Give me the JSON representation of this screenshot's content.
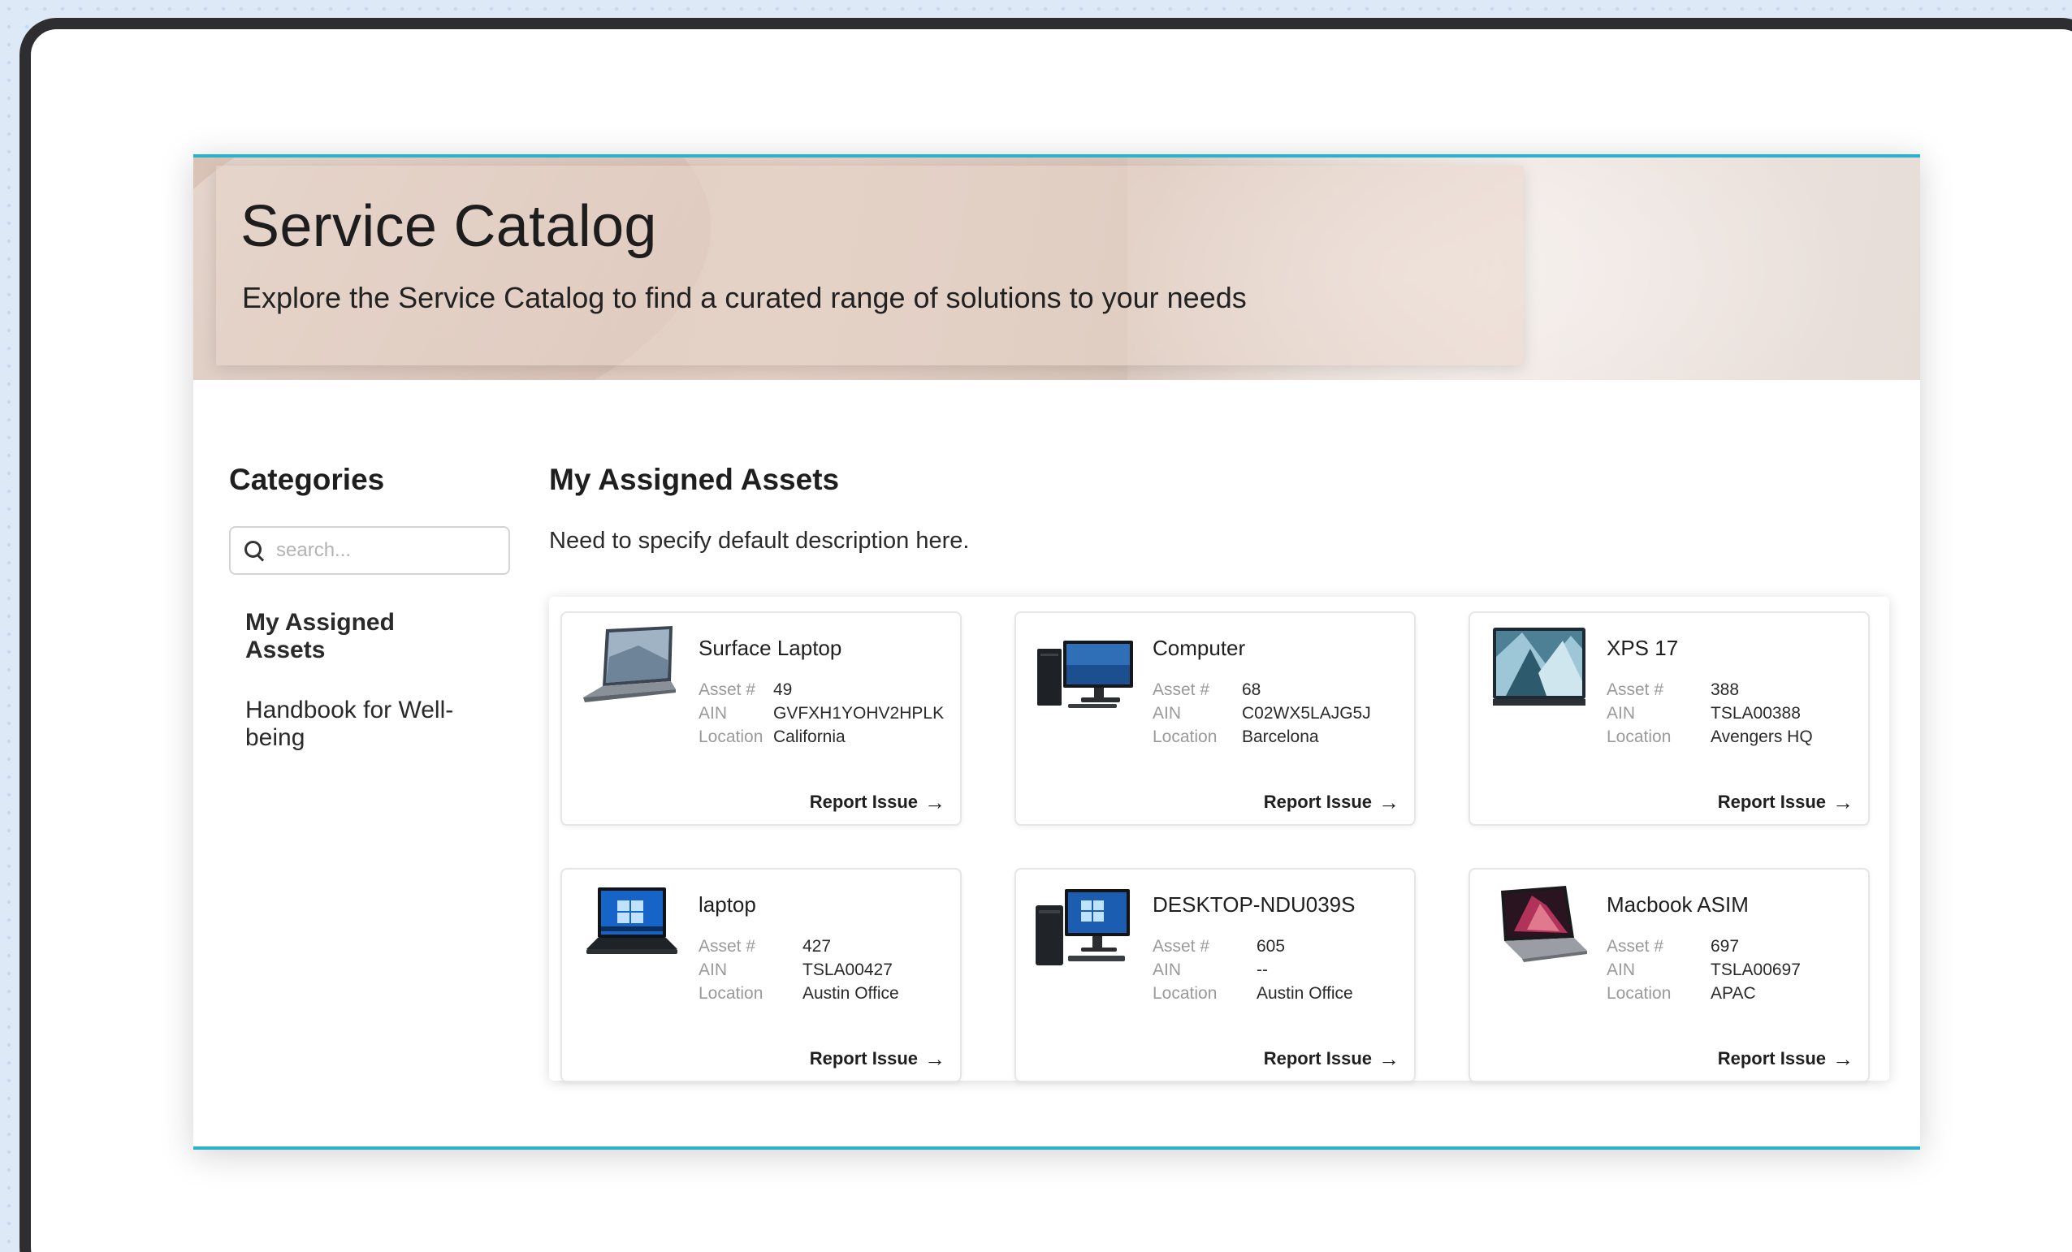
{
  "header": {
    "title": "Service Catalog",
    "subtitle": "Explore the Service Catalog to find a curated range of solutions to your needs"
  },
  "sidebar": {
    "title": "Categories",
    "search_placeholder": "search...",
    "items": [
      {
        "label": "My Assigned Assets",
        "active": true
      },
      {
        "label": "Handbook for Well-being",
        "active": false
      }
    ]
  },
  "main": {
    "title": "My Assigned Assets",
    "description": "Need to specify default description here.",
    "labels": {
      "asset": "Asset #",
      "ain": "AIN",
      "location": "Location",
      "report": "Report Issue"
    },
    "assets": [
      {
        "name": "Surface Laptop",
        "asset_no": "49",
        "ain": "GVFXH1YOHV2HPLK",
        "location": "California",
        "icon": "laptop-icon"
      },
      {
        "name": "Computer",
        "asset_no": "68",
        "ain": "C02WX5LAJG5J",
        "location": "Barcelona",
        "icon": "desktop-icon"
      },
      {
        "name": "XPS 17",
        "asset_no": "388",
        "ain": "TSLA00388",
        "location": "Avengers HQ",
        "icon": "laptop-icon"
      },
      {
        "name": "laptop",
        "asset_no": "427",
        "ain": "TSLA00427",
        "location": "Austin Office",
        "icon": "laptop-icon"
      },
      {
        "name": "DESKTOP-NDU039S",
        "asset_no": "605",
        "ain": "--",
        "location": "Austin Office",
        "icon": "desktop-icon"
      },
      {
        "name": "Macbook ASIM",
        "asset_no": "697",
        "ain": "TSLA00697",
        "location": "APAC",
        "icon": "laptop-icon"
      }
    ]
  },
  "colors": {
    "accent": "#2ab3c8",
    "hero": "#d9c3b6"
  }
}
